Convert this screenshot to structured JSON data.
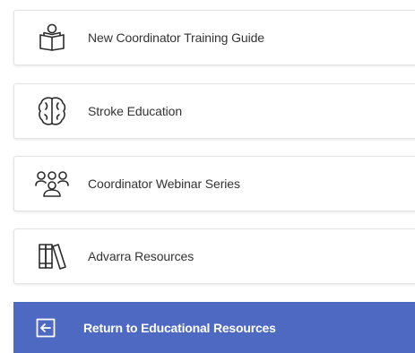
{
  "menu": {
    "items": [
      {
        "label": "New Coordinator Training Guide",
        "icon": "reader-book-icon"
      },
      {
        "label": "Stroke Education",
        "icon": "brain-icon"
      },
      {
        "label": "Coordinator Webinar Series",
        "icon": "group-people-icon"
      },
      {
        "label": "Advarra Resources",
        "icon": "library-books-icon"
      }
    ],
    "return": {
      "label": "Return to Educational Resources",
      "icon": "arrow-left-box-icon"
    }
  },
  "colors": {
    "accent": "#4e69c2",
    "icon_stroke": "#2b2b2b",
    "card_border": "#e3e3e6",
    "text": "#333333"
  }
}
